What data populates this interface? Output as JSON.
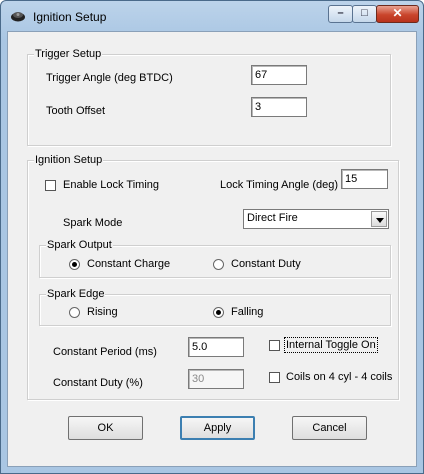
{
  "window": {
    "title": "Ignition Setup",
    "minimize": "–",
    "maximize": "□",
    "close": "✕"
  },
  "trigger": {
    "legend": "Trigger Setup",
    "angle_label": "Trigger Angle (deg BTDC)",
    "angle_value": "67",
    "offset_label": "Tooth Offset",
    "offset_value": "3"
  },
  "ignition": {
    "legend": "Ignition Setup",
    "lock_timing_label": "Enable Lock Timing",
    "lock_timing_checked": false,
    "lock_angle_label": "Lock Timing Angle (deg)",
    "lock_angle_value": "15",
    "spark_mode_label": "Spark Mode",
    "spark_mode_value": "Direct Fire",
    "spark_output": {
      "legend": "Spark Output",
      "option_charge": "Constant Charge",
      "option_duty": "Constant Duty",
      "selected": "Constant Charge"
    },
    "spark_edge": {
      "legend": "Spark Edge",
      "option_rising": "Rising",
      "option_falling": "Falling",
      "selected": "Falling"
    },
    "period_label": "Constant Period (ms)",
    "period_value": "5.0",
    "duty_label": "Constant Duty (%)",
    "duty_value": "30",
    "toggle_label": "Internal Toggle On",
    "toggle_checked": false,
    "coils_label": "Coils on 4 cyl - 4 coils",
    "coils_checked": false
  },
  "buttons": {
    "ok": "OK",
    "apply": "Apply",
    "cancel": "Cancel"
  },
  "colors": {
    "title_bar": "#a9c6e3",
    "close_button": "#c9452c",
    "dialog_bg": "#f0f0f0",
    "default_button_border": "#3c7fb1"
  }
}
